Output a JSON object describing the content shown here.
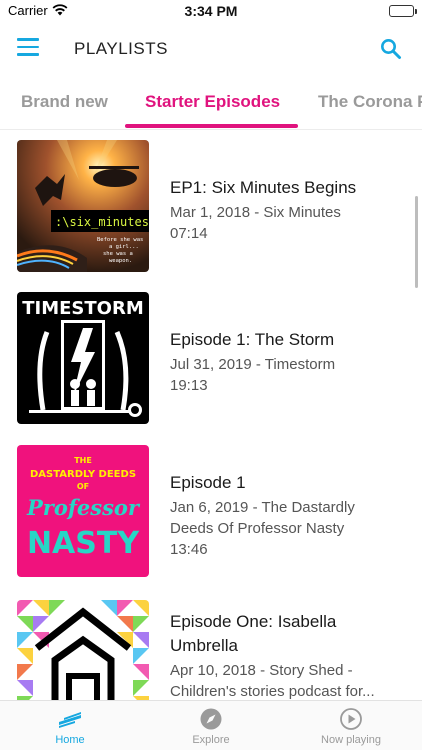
{
  "status_bar": {
    "carrier": "Carrier",
    "time": "3:34 PM"
  },
  "header": {
    "title": "PLAYLISTS"
  },
  "tabs": [
    {
      "label": "Brand new"
    },
    {
      "label": "Starter Episodes",
      "active": true
    },
    {
      "label": "The Corona P"
    }
  ],
  "episodes": [
    {
      "title": "EP1: Six Minutes Begins",
      "line1": "Mar 1, 2018 - Six Minutes",
      "line2": "07:14",
      "art": {
        "text": ":\\six_minutes",
        "tagline1": "Before she was",
        "tagline2": "a girl...",
        "tagline3": "she was a",
        "tagline4": "weapon."
      }
    },
    {
      "title": "Episode 1: The Storm",
      "line1": "Jul 31, 2019 - Timestorm",
      "line2": "19:13",
      "art": {
        "text": "TIMESTORM"
      }
    },
    {
      "title": "Episode 1",
      "line1": "Jan 6, 2019 - The Dastardly",
      "line2": "Deeds Of Professor Nasty",
      "line3": "13:46",
      "art": {
        "text1": "THE",
        "text2": "DASTARDLY DEEDS",
        "text3": "OF",
        "text4": "Professor",
        "text5": "NASTY"
      }
    },
    {
      "title": "Episode One: Isabella",
      "title2": "Umbrella",
      "line1": "Apr 10, 2018 - Story Shed -",
      "line2": "Children's stories podcast for..."
    }
  ],
  "bottom_nav": [
    {
      "label": "Home",
      "icon": "home-stripes-icon",
      "active": true
    },
    {
      "label": "Explore",
      "icon": "compass-icon"
    },
    {
      "label": "Now playing",
      "icon": "play-circle-icon"
    }
  ],
  "colors": {
    "accent": "#e0137e",
    "brand": "#16a8e0"
  }
}
